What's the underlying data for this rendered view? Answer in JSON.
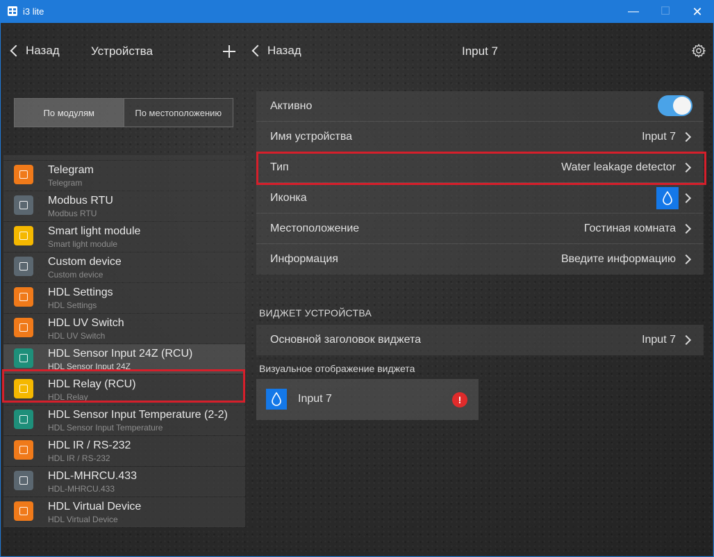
{
  "window": {
    "title": "i3 lite",
    "minimize_glyph": "—",
    "maximize_glyph": "☐",
    "close_glyph": "✕"
  },
  "left": {
    "back_label": "Назад",
    "title": "Устройства",
    "segments": [
      "По модулям",
      "По местоположению"
    ],
    "devices": [
      {
        "name": "Telegram",
        "subtitle": "Telegram",
        "color": "#f07a1a",
        "icon": "telegram-icon"
      },
      {
        "name": "Modbus RTU",
        "subtitle": "Modbus RTU",
        "color": "#5b6770",
        "icon": "modbus-icon"
      },
      {
        "name": "Smart light module",
        "subtitle": "Smart light module",
        "color": "#f5b800",
        "icon": "lightbulb-icon"
      },
      {
        "name": "Custom device",
        "subtitle": "Custom device",
        "color": "#5b6770",
        "icon": "custom-device-icon"
      },
      {
        "name": "HDL Settings",
        "subtitle": "HDL Settings",
        "color": "#f07a1a",
        "icon": "settings-module-icon"
      },
      {
        "name": "HDL UV Switch",
        "subtitle": "HDL UV Switch",
        "color": "#f07a1a",
        "icon": "uv-switch-icon"
      },
      {
        "name": "HDL Sensor Input 24Z (RCU)",
        "subtitle": "HDL Sensor Input 24Z",
        "color": "#1e8f7a",
        "icon": "sensor-input-icon"
      },
      {
        "name": "HDL Relay (RCU)",
        "subtitle": "HDL Relay",
        "color": "#f5b800",
        "icon": "relay-icon"
      },
      {
        "name": "HDL Sensor Input Temperature (2-2)",
        "subtitle": "HDL Sensor Input Temperature",
        "color": "#1e8f7a",
        "icon": "thermometer-icon"
      },
      {
        "name": "HDL IR / RS-232",
        "subtitle": "HDL IR / RS-232",
        "color": "#f07a1a",
        "icon": "ir-icon"
      },
      {
        "name": "HDL-MHRCU.433",
        "subtitle": "HDL-MHRCU.433",
        "color": "#5b6770",
        "icon": "rcu-icon"
      },
      {
        "name": "HDL Virtual Device",
        "subtitle": "HDL Virtual Device",
        "color": "#f07a1a",
        "icon": "virtual-device-icon"
      }
    ]
  },
  "right": {
    "back_label": "Назад",
    "title": "Input 7",
    "rows": {
      "active_label": "Активно",
      "name_label": "Имя устройства",
      "name_value": "Input 7",
      "type_label": "Тип",
      "type_value": "Water leakage detector",
      "icon_label": "Иконка",
      "location_label": "Местоположение",
      "location_value": "Гостиная комната",
      "info_label": "Информация",
      "info_value": "Введите информацию"
    },
    "widget_section_title": "ВИДЖЕТ УСТРОЙСТВА",
    "widget_title_label": "Основной заголовок виджета",
    "widget_title_value": "Input 7",
    "widget_view_label": "Визуальное отображение виджета",
    "widget_preview_name": "Input 7",
    "alert_glyph": "!"
  },
  "colors": {
    "accent": "#1f7ad9",
    "toggle_on": "#4aa3e8",
    "icon_blue": "#1478e8",
    "highlight_red": "#d61f2b",
    "alert_red": "#e02b2b"
  }
}
